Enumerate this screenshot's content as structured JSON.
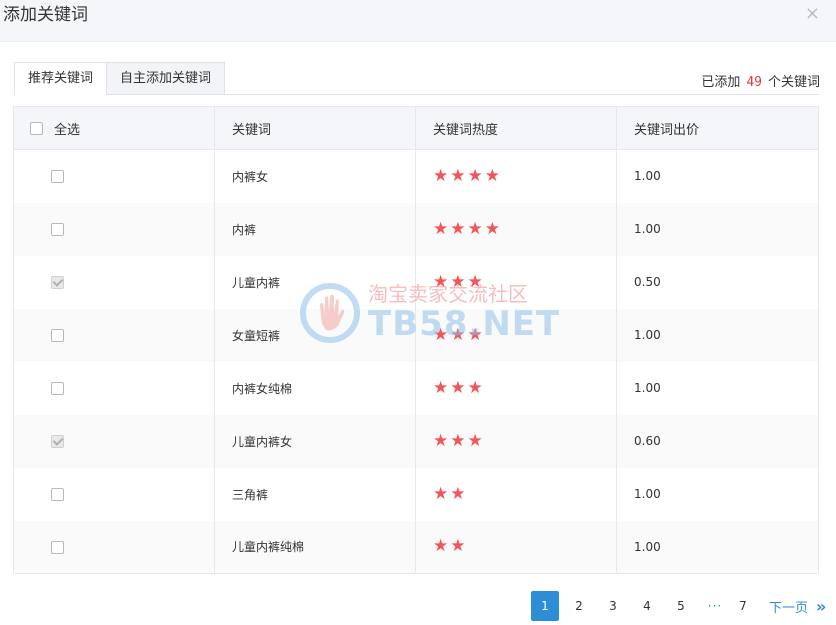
{
  "dialog": {
    "title": "添加关键词",
    "close_icon": "×"
  },
  "tabs": [
    {
      "label": "推荐关键词",
      "active": true
    },
    {
      "label": "自主添加关键词",
      "active": false
    }
  ],
  "counter": {
    "prefix": "已添加",
    "value": "49",
    "suffix": "个关键词"
  },
  "table": {
    "headers": {
      "select_all": "全选",
      "keyword": "关键词",
      "heat": "关键词热度",
      "bid": "关键词出价"
    },
    "rows": [
      {
        "keyword": "内裤女",
        "heat": 4,
        "bid": "1.00",
        "checked": false
      },
      {
        "keyword": "内裤",
        "heat": 4,
        "bid": "1.00",
        "checked": false
      },
      {
        "keyword": "儿童内裤",
        "heat": 3,
        "bid": "0.50",
        "checked": true
      },
      {
        "keyword": "女童短裤",
        "heat": 3,
        "bid": "1.00",
        "checked": false
      },
      {
        "keyword": "内裤女纯棉",
        "heat": 3,
        "bid": "1.00",
        "checked": false
      },
      {
        "keyword": "儿童内裤女",
        "heat": 3,
        "bid": "0.60",
        "checked": true
      },
      {
        "keyword": "三角裤",
        "heat": 2,
        "bid": "1.00",
        "checked": false
      },
      {
        "keyword": "儿童内裤纯棉",
        "heat": 2,
        "bid": "1.00",
        "checked": false
      }
    ],
    "star_icon": "star-icon",
    "star_color": "#f2555a"
  },
  "pagination": {
    "pages": [
      "1",
      "2",
      "3",
      "4",
      "5"
    ],
    "current": "1",
    "ellipsis": "···",
    "last": "7",
    "next_label": "下一页",
    "next_icon": "»"
  },
  "watermark": {
    "cn": "淘宝卖家交流社区",
    "en": "TB58.NET"
  },
  "colors": {
    "accent": "#2e8ed5",
    "count": "#e4393c",
    "header_bg": "#f5f6fa"
  }
}
